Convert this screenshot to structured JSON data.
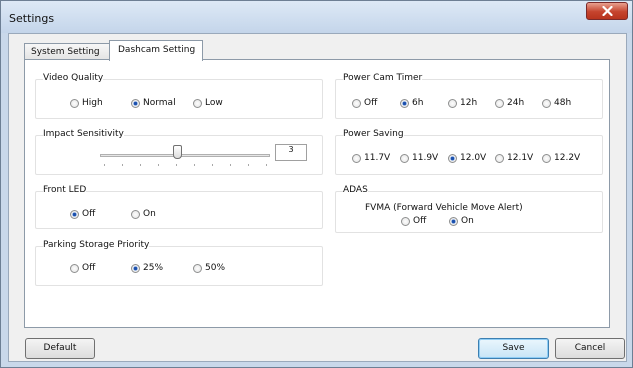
{
  "window": {
    "title": "Settings"
  },
  "tabs": [
    {
      "label": "System Setting",
      "active": false
    },
    {
      "label": "Dashcam Setting",
      "active": true
    }
  ],
  "video_quality": {
    "label": "Video Quality",
    "options": [
      "High",
      "Normal",
      "Low"
    ],
    "selected": "Normal"
  },
  "impact_sensitivity": {
    "label": "Impact Sensitivity",
    "value": "3",
    "level": 4,
    "max": 9
  },
  "front_led": {
    "label": "Front LED",
    "options": [
      "Off",
      "On"
    ],
    "selected": "Off"
  },
  "parking_storage": {
    "label": "Parking Storage Priority",
    "options": [
      "Off",
      "25%",
      "50%"
    ],
    "selected": "25%"
  },
  "power_cam_timer": {
    "label": "Power Cam Timer",
    "options": [
      "Off",
      "6h",
      "12h",
      "24h",
      "48h"
    ],
    "selected": "6h"
  },
  "power_saving": {
    "label": "Power Saving",
    "options": [
      "11.7V",
      "11.9V",
      "12.0V",
      "12.1V",
      "12.2V"
    ],
    "selected": "12.0V"
  },
  "adas": {
    "label": "ADAS",
    "fvma_label": "FVMA (Forward Vehicle Move Alert)",
    "options": [
      "Off",
      "On"
    ],
    "selected": "On"
  },
  "buttons": {
    "default": "Default",
    "save": "Save",
    "cancel": "Cancel"
  },
  "colors": {
    "title_bg": "#c9d8ea",
    "radio_on": "#1d4fa8",
    "close_btn": "#c5432d"
  }
}
